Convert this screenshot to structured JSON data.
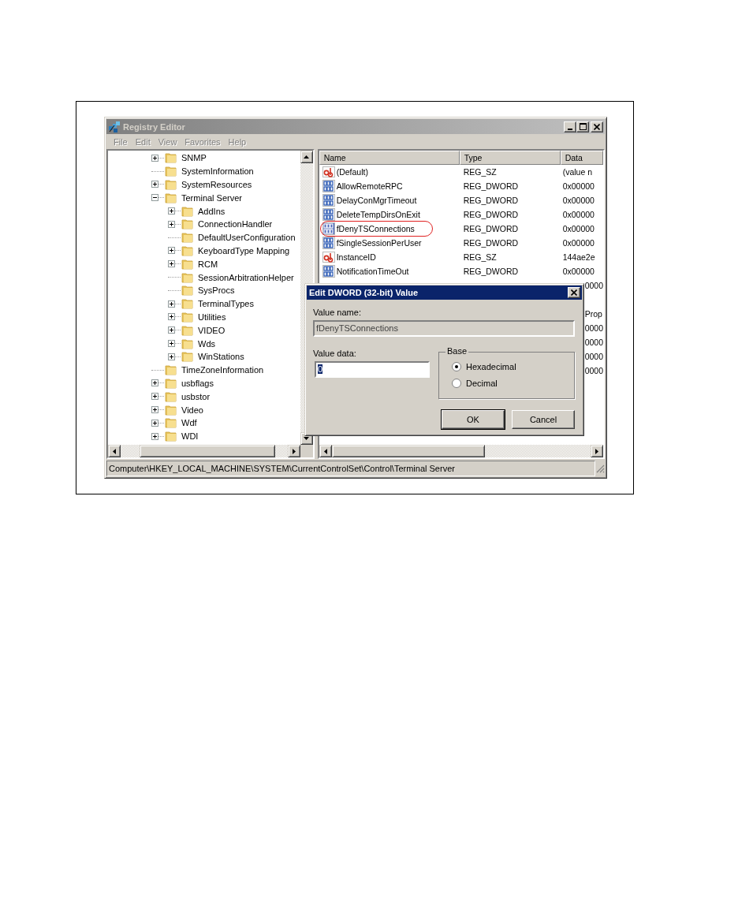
{
  "window": {
    "title": "Registry Editor",
    "active": false
  },
  "menu": [
    {
      "label": "File",
      "disabled": true
    },
    {
      "label": "Edit",
      "disabled": true
    },
    {
      "label": "View",
      "disabled": true
    },
    {
      "label": "Favorites",
      "disabled": true
    },
    {
      "label": "Help",
      "disabled": true
    }
  ],
  "tree": {
    "items": [
      {
        "label": "SNMP",
        "expandable": true,
        "expanded": false
      },
      {
        "label": "SystemInformation",
        "expandable": false
      },
      {
        "label": "SystemResources",
        "expandable": true,
        "expanded": false
      },
      {
        "label": "Terminal Server",
        "expandable": true,
        "expanded": true,
        "children": [
          {
            "label": "AddIns",
            "expandable": true,
            "expanded": false
          },
          {
            "label": "ConnectionHandler",
            "expandable": true,
            "expanded": false
          },
          {
            "label": "DefaultUserConfiguration",
            "expandable": false
          },
          {
            "label": "KeyboardType Mapping",
            "expandable": true,
            "expanded": false
          },
          {
            "label": "RCM",
            "expandable": true,
            "expanded": false
          },
          {
            "label": "SessionArbitrationHelper",
            "expandable": false
          },
          {
            "label": "SysProcs",
            "expandable": false
          },
          {
            "label": "TerminalTypes",
            "expandable": true,
            "expanded": false
          },
          {
            "label": "Utilities",
            "expandable": true,
            "expanded": false
          },
          {
            "label": "VIDEO",
            "expandable": true,
            "expanded": false
          },
          {
            "label": "Wds",
            "expandable": true,
            "expanded": false
          },
          {
            "label": "WinStations",
            "expandable": true,
            "expanded": false
          }
        ]
      },
      {
        "label": "TimeZoneInformation",
        "expandable": false
      },
      {
        "label": "usbflags",
        "expandable": true,
        "expanded": false
      },
      {
        "label": "usbstor",
        "expandable": true,
        "expanded": false
      },
      {
        "label": "Video",
        "expandable": true,
        "expanded": false
      },
      {
        "label": "Wdf",
        "expandable": true,
        "expanded": false
      },
      {
        "label": "WDI",
        "expandable": true,
        "expanded": false
      }
    ]
  },
  "list": {
    "columns": [
      "Name",
      "Type",
      "Data"
    ],
    "rows": [
      {
        "kind": "string",
        "name": "(Default)",
        "type": "REG_SZ",
        "data": "(value n",
        "selected": false,
        "annotated": false
      },
      {
        "kind": "dword",
        "name": "AllowRemoteRPC",
        "type": "REG_DWORD",
        "data": "0x00000",
        "selected": false,
        "annotated": false
      },
      {
        "kind": "dword",
        "name": "DelayConMgrTimeout",
        "type": "REG_DWORD",
        "data": "0x00000",
        "selected": false,
        "annotated": false
      },
      {
        "kind": "dword",
        "name": "DeleteTempDirsOnExit",
        "type": "REG_DWORD",
        "data": "0x00000",
        "selected": false,
        "annotated": false
      },
      {
        "kind": "dword",
        "name": "fDenyTSConnections",
        "type": "REG_DWORD",
        "data": "0x00000",
        "selected": true,
        "annotated": true
      },
      {
        "kind": "dword",
        "name": "fSingleSessionPerUser",
        "type": "REG_DWORD",
        "data": "0x00000",
        "selected": false,
        "annotated": false
      },
      {
        "kind": "string",
        "name": "InstanceID",
        "type": "REG_SZ",
        "data": "144ae2e",
        "selected": false,
        "annotated": false
      },
      {
        "kind": "dword",
        "name": "NotificationTimeOut",
        "type": "REG_DWORD",
        "data": "0x00000",
        "selected": false,
        "annotated": false
      }
    ],
    "covered_rows": [
      {
        "data": "0000"
      },
      {},
      {
        "data": "Prop"
      },
      {
        "data": "0000"
      },
      {
        "data": "0000"
      },
      {
        "data": "0000"
      },
      {
        "data": "0000"
      }
    ]
  },
  "status_bar": "Computer\\HKEY_LOCAL_MACHINE\\SYSTEM\\CurrentControlSet\\Control\\Terminal Server",
  "dialog": {
    "title": "Edit DWORD (32-bit) Value",
    "value_name_label": "Value name:",
    "value_name": "fDenyTSConnections",
    "value_data_label": "Value data:",
    "value_data": "0",
    "base_label": "Base",
    "base_options": [
      {
        "label": "Hexadecimal",
        "selected": true
      },
      {
        "label": "Decimal",
        "selected": false
      }
    ],
    "buttons": [
      {
        "label": "OK",
        "default": true
      },
      {
        "label": "Cancel",
        "default": false
      }
    ]
  }
}
